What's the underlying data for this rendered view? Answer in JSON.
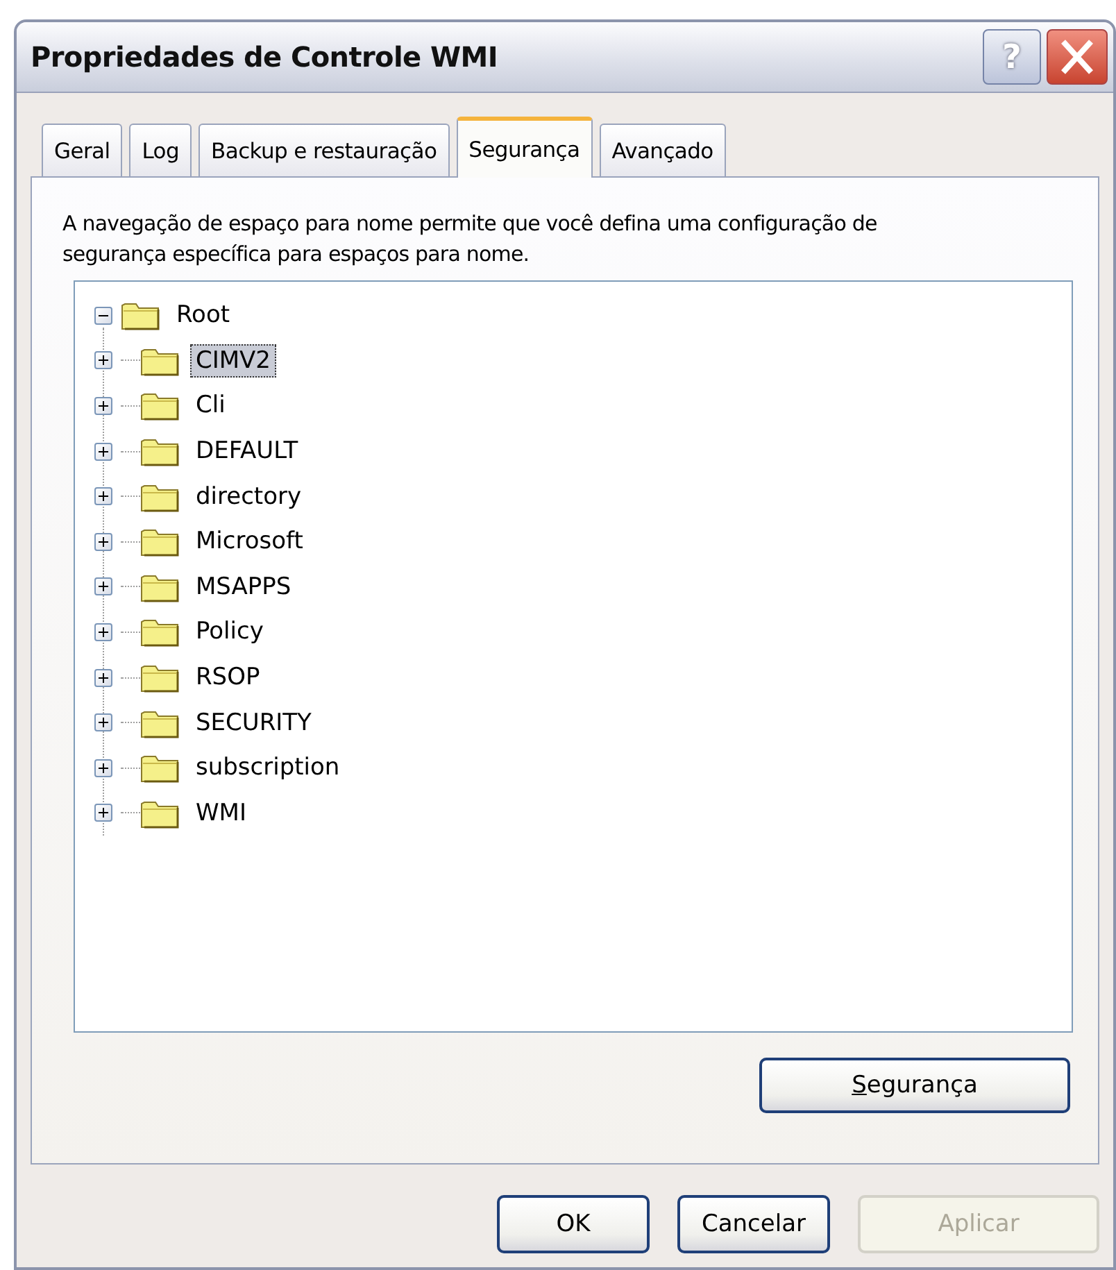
{
  "window": {
    "title": "Propriedades de Controle WMI",
    "help_button": "?"
  },
  "tabs": [
    {
      "label": "Geral",
      "selected": false
    },
    {
      "label": "Log",
      "selected": false
    },
    {
      "label": "Backup e restauração",
      "selected": false
    },
    {
      "label": "Segurança",
      "selected": true
    },
    {
      "label": "Avançado",
      "selected": false
    }
  ],
  "description": "A navegação de espaço para nome permite que você defina uma configuração de segurança específica para espaços para nome.",
  "tree": [
    {
      "label": "Root",
      "expanded": true,
      "selected": false,
      "children": [
        {
          "label": "CIMV2",
          "expanded": false,
          "selected": true
        },
        {
          "label": "Cli",
          "expanded": false,
          "selected": false
        },
        {
          "label": "DEFAULT",
          "expanded": false,
          "selected": false
        },
        {
          "label": "directory",
          "expanded": false,
          "selected": false
        },
        {
          "label": "Microsoft",
          "expanded": false,
          "selected": false
        },
        {
          "label": "MSAPPS",
          "expanded": false,
          "selected": false
        },
        {
          "label": "Policy",
          "expanded": false,
          "selected": false
        },
        {
          "label": "RSOP",
          "expanded": false,
          "selected": false
        },
        {
          "label": "SECURITY",
          "expanded": false,
          "selected": false
        },
        {
          "label": "subscription",
          "expanded": false,
          "selected": false
        },
        {
          "label": "WMI",
          "expanded": false,
          "selected": false
        }
      ]
    }
  ],
  "security_button": {
    "label": "Segurança",
    "mnemonic_underlined": true
  },
  "buttons": [
    {
      "label": "OK",
      "disabled": false
    },
    {
      "label": "Cancelar",
      "disabled": false
    },
    {
      "label": "Aplicar",
      "disabled": true
    }
  ]
}
